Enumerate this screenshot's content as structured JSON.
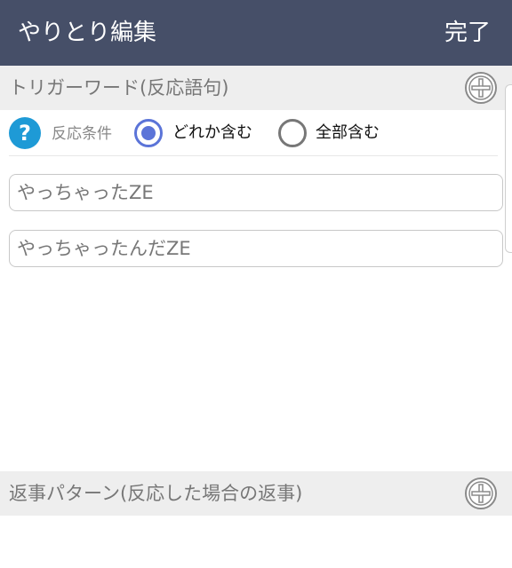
{
  "header": {
    "title": "やりとり編集",
    "done_label": "完了"
  },
  "triggers": {
    "section_title": "トリガーワード(反応語句)",
    "condition_label": "反応条件",
    "options": [
      {
        "label": "どれか含む",
        "selected": true
      },
      {
        "label": "全部含む",
        "selected": false
      }
    ],
    "words": [
      "やっちゃったZE",
      "やっちゃったんだZE"
    ]
  },
  "replies": {
    "section_title": "返事パターン(反応した場合の返事)"
  },
  "colors": {
    "appbar": "#464f68",
    "radio_selected": "#5b74d8",
    "help_icon": "#1e9ad6"
  }
}
